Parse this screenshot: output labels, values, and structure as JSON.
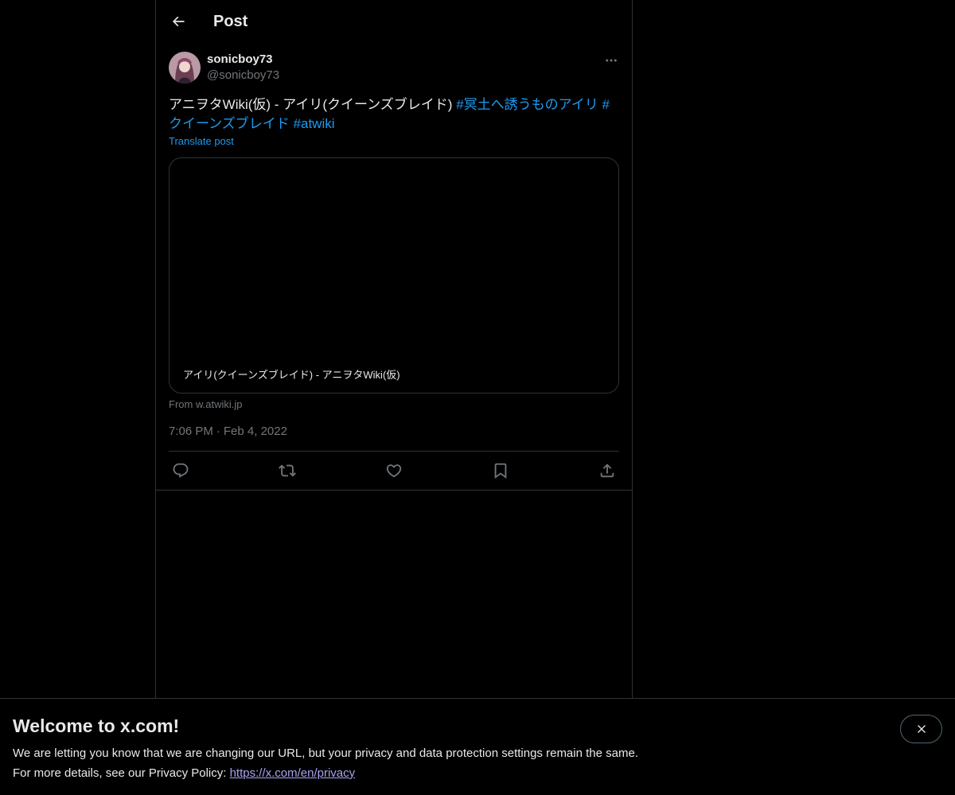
{
  "header": {
    "title": "Post"
  },
  "post": {
    "author": {
      "display_name": "sonicboy73",
      "handle": "@sonicboy73"
    },
    "text_plain": "アニヲタWiki(仮) - アイリ(クイーンズブレイド) ",
    "hashtags": [
      "#冥土へ誘うものアイリ",
      "#クイーンズブレイド",
      "#atwiki"
    ],
    "translate_label": "Translate post",
    "card": {
      "title": "アイリ(クイーンズブレイド) - アニヲタWiki(仮)",
      "source": "From w.atwiki.jp"
    },
    "time": "7:06 PM",
    "separator": "·",
    "date": "Feb 4, 2022"
  },
  "actions": {
    "icons": [
      "reply-icon",
      "repost-icon",
      "like-icon",
      "bookmark-icon",
      "share-icon"
    ]
  },
  "banner": {
    "title": "Welcome to x.com!",
    "line1": "We are letting you know that we are changing our URL, but your privacy and data protection settings remain the same.",
    "line2_prefix": "For more details, see our Privacy Policy: ",
    "link": "https://x.com/en/privacy"
  },
  "colors": {
    "background": "#000000",
    "text": "#e7e9ea",
    "muted": "#71767b",
    "accent": "#1d9bf0",
    "border": "#2f3336"
  }
}
